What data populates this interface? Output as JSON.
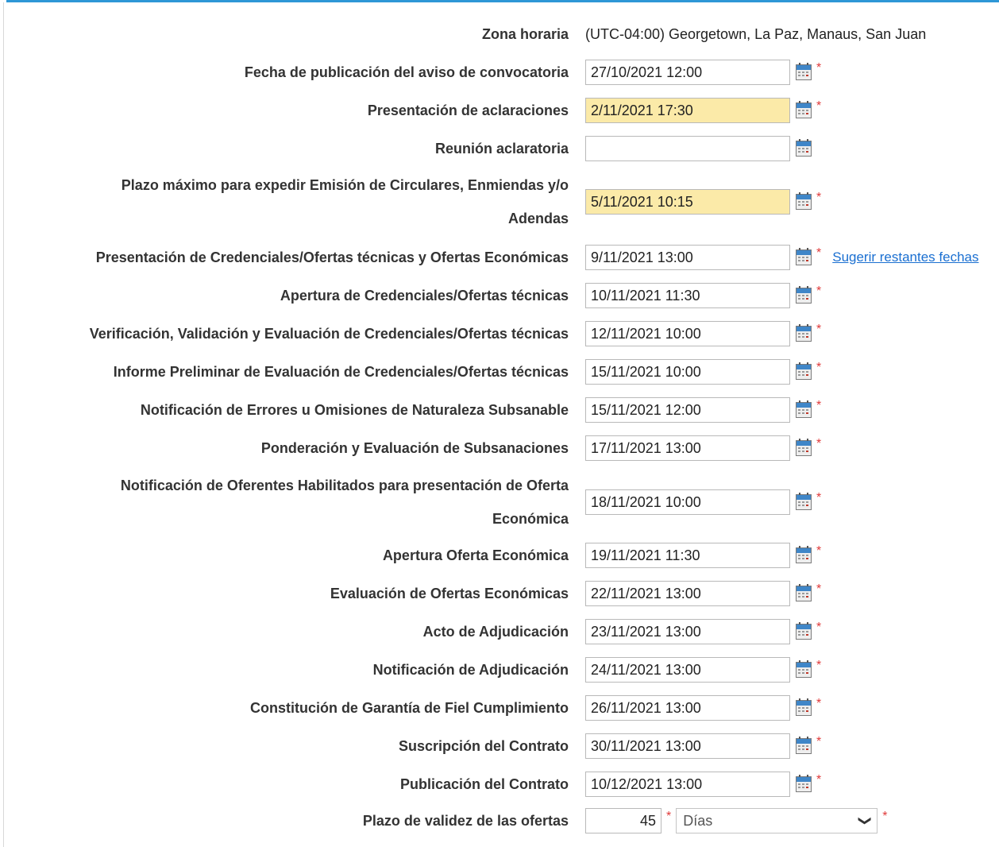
{
  "timezone": {
    "label": "Zona horaria",
    "value": "(UTC-04:00) Georgetown, La Paz, Manaus, San Juan"
  },
  "schedule": [
    {
      "label": "Fecha de publicación del aviso de convocatoria",
      "value": "27/10/2021 12:00",
      "required": true,
      "highlighted": false
    },
    {
      "label": "Presentación de aclaraciones",
      "value": "2/11/2021 17:30",
      "required": true,
      "highlighted": true
    },
    {
      "label": "Reunión aclaratoria",
      "value": "",
      "required": false,
      "highlighted": false
    },
    {
      "label_line1": "Plazo máximo para expedir Emisión de Circulares, Enmiendas y/o",
      "label_line2": "Adendas",
      "value": "5/11/2021 10:15",
      "required": true,
      "highlighted": true
    },
    {
      "label": "Presentación de Credenciales/Ofertas técnicas y Ofertas Económicas",
      "value": "9/11/2021 13:00",
      "required": true,
      "highlighted": false
    },
    {
      "label": "Apertura de Credenciales/Ofertas técnicas",
      "value": "10/11/2021 11:30",
      "required": true,
      "highlighted": false
    },
    {
      "label": "Verificación, Validación y Evaluación de Credenciales/Ofertas técnicas",
      "value": "12/11/2021 10:00",
      "required": true,
      "highlighted": false
    },
    {
      "label": "Informe Preliminar de Evaluación de Credenciales/Ofertas técnicas",
      "value": "15/11/2021 10:00",
      "required": true,
      "highlighted": false
    },
    {
      "label": "Notificación de Errores u Omisiones de Naturaleza Subsanable",
      "value": "15/11/2021 12:00",
      "required": true,
      "highlighted": false
    },
    {
      "label": "Ponderación y Evaluación de Subsanaciones",
      "value": "17/11/2021 13:00",
      "required": true,
      "highlighted": false
    },
    {
      "label_line1": "Notificación de Oferentes Habilitados para presentación de Oferta",
      "label_line2": "Económica",
      "value": "18/11/2021 10:00",
      "required": true,
      "highlighted": false
    },
    {
      "label": "Apertura Oferta Económica",
      "value": "19/11/2021 11:30",
      "required": true,
      "highlighted": false
    },
    {
      "label": "Evaluación de Ofertas Económicas",
      "value": "22/11/2021 13:00",
      "required": true,
      "highlighted": false
    },
    {
      "label": "Acto de Adjudicación",
      "value": "23/11/2021 13:00",
      "required": true,
      "highlighted": false
    },
    {
      "label": "Notificación de Adjudicación",
      "value": "24/11/2021 13:00",
      "required": true,
      "highlighted": false
    },
    {
      "label": "Constitución de Garantía de Fiel Cumplimiento",
      "value": "26/11/2021 13:00",
      "required": true,
      "highlighted": false
    },
    {
      "label": "Suscripción del Contrato",
      "value": "30/11/2021 13:00",
      "required": true,
      "highlighted": false
    },
    {
      "label": "Publicación del Contrato",
      "value": "10/12/2021 13:00",
      "required": true,
      "highlighted": false
    }
  ],
  "suggest_link": "Sugerir restantes fechas",
  "required_mark": "*",
  "validity": {
    "label": "Plazo de validez de las ofertas",
    "amount": "45",
    "unit": "Días"
  },
  "colors": {
    "accent": "#2e97d6",
    "highlight": "#fbeaa8",
    "required": "#e03a3a",
    "link": "#1a6fd1"
  },
  "icons": {
    "calendar": "calendar-icon",
    "dropdown": "chevron-down-icon"
  }
}
